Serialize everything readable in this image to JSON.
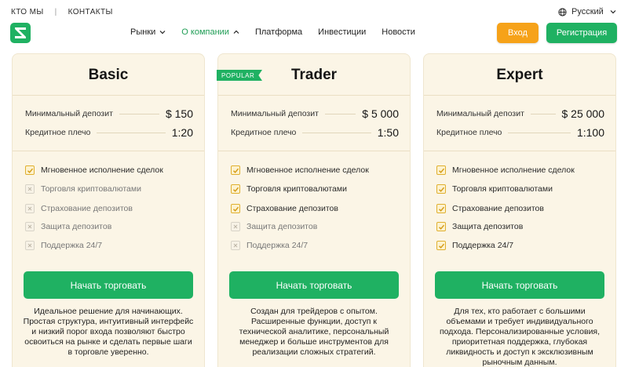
{
  "topbar": {
    "about": "КТО МЫ",
    "separator": "|",
    "contacts": "КОНТАКТЫ",
    "language": "Русский"
  },
  "nav": {
    "items": [
      {
        "label": "Рынки",
        "has_dropdown": true,
        "active": false
      },
      {
        "label": "О компании",
        "has_dropdown": true,
        "active": true
      },
      {
        "label": "Платформа",
        "has_dropdown": false,
        "active": false
      },
      {
        "label": "Инвестиции",
        "has_dropdown": false,
        "active": false
      },
      {
        "label": "Новости",
        "has_dropdown": false,
        "active": false
      }
    ],
    "login_label": "Вход",
    "register_label": "Регистрация"
  },
  "colors": {
    "brand_green": "#1fb162",
    "login_orange": "#f6a219",
    "card_bg": "#fbf5e6",
    "active_nav": "#1f9d55",
    "check_gold": "#e0b02f"
  },
  "plans": [
    {
      "name": "Basic",
      "badge": "",
      "min_deposit_label": "Минимальный депозит",
      "min_deposit": "$ 150",
      "leverage_label": "Кредитное плечо",
      "leverage": "1:20",
      "features": [
        {
          "label": "Мгновенное исполнение сделок",
          "included": true
        },
        {
          "label": "Торговля криптовалютами",
          "included": false
        },
        {
          "label": "Страхование депозитов",
          "included": false
        },
        {
          "label": "Защита депозитов",
          "included": false
        },
        {
          "label": "Поддержка 24/7",
          "included": false
        }
      ],
      "cta": "Начать торговать",
      "description": "Идеальное решение для начинающих. Простая структура, интуитивный интерфейс и низкий порог входа позволяют быстро освоиться на рынке и сделать первые шаги в торговле уверенно."
    },
    {
      "name": "Trader",
      "badge": "POPULAR",
      "min_deposit_label": "Минимальный депозит",
      "min_deposit": "$ 5 000",
      "leverage_label": "Кредитное плечо",
      "leverage": "1:50",
      "features": [
        {
          "label": "Мгновенное исполнение сделок",
          "included": true
        },
        {
          "label": "Торговля криптовалютами",
          "included": true
        },
        {
          "label": "Страхование депозитов",
          "included": true
        },
        {
          "label": "Защита депозитов",
          "included": false
        },
        {
          "label": "Поддержка 24/7",
          "included": false
        }
      ],
      "cta": "Начать торговать",
      "description": "Создан для трейдеров с опытом. Расширенные функции, доступ к технической аналитике, персональный менеджер и больше инструментов для реализации сложных стратегий."
    },
    {
      "name": "Expert",
      "badge": "",
      "min_deposit_label": "Минимальный депозит",
      "min_deposit": "$ 25 000",
      "leverage_label": "Кредитное плечо",
      "leverage": "1:100",
      "features": [
        {
          "label": "Мгновенное исполнение сделок",
          "included": true
        },
        {
          "label": "Торговля криптовалютами",
          "included": true
        },
        {
          "label": "Страхование депозитов",
          "included": true
        },
        {
          "label": "Защита депозитов",
          "included": true
        },
        {
          "label": "Поддержка 24/7",
          "included": true
        }
      ],
      "cta": "Начать торговать",
      "description": "Для тех, кто работает с большими объемами и требует индивидуального подхода. Персонализированные условия, приоритетная поддержка, глубокая ликвидность и доступ к эксклюзивным рыночным данным."
    }
  ]
}
